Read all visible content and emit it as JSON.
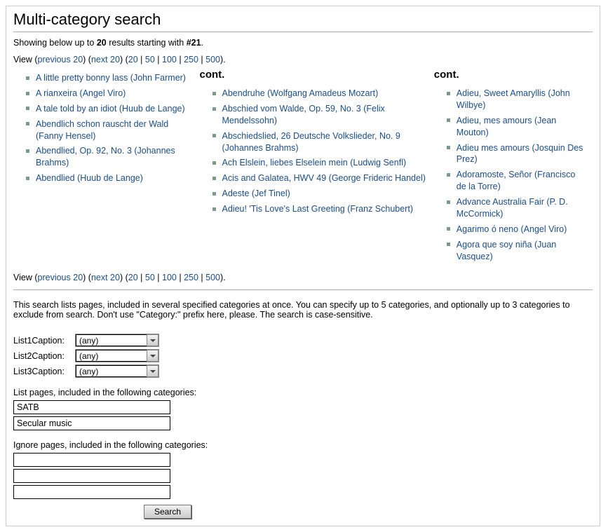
{
  "title": "Multi-category search",
  "summary_pre": "Showing below up to ",
  "summary_count": "20",
  "summary_mid": " results starting with ",
  "summary_start": "#21",
  "summary_post": ".",
  "nav": {
    "view_label": "View (",
    "prev": "previous 20",
    "sep1": ") (",
    "next": "next 20",
    "sep2": ") (",
    "n20": "20",
    "n50": "50",
    "n100": "100",
    "n250": "250",
    "n500": "500",
    "close": ").",
    "pipe": " | "
  },
  "cont_label": "cont.",
  "col1": [
    "A little pretty bonny lass (John Farmer)",
    "A rianxeira (Angel Viro)",
    "A tale told by an idiot (Huub de Lange)",
    "Abendlich schon rauscht der Wald (Fanny Hensel)",
    "Abendlied, Op. 92, No. 3 (Johannes Brahms)",
    "Abendlied (Huub de Lange)"
  ],
  "col2": [
    "Abendruhe (Wolfgang Amadeus Mozart)",
    "Abschied vom Walde, Op. 59, No. 3 (Felix Mendelssohn)",
    "Abschiedslied, 26 Deutsche Volkslieder, No. 9 (Johannes Brahms)",
    "Ach Elslein, liebes Elselein mein (Ludwig Senfl)",
    "Acis and Galatea, HWV 49 (George Frideric Handel)",
    "Adeste (Jef Tinel)",
    "Adieu! 'Tis Love's Last Greeting (Franz Schubert)"
  ],
  "col3": [
    "Adieu, Sweet Amaryllis (John Wilbye)",
    "Adieu, mes amours (Jean Mouton)",
    "Adieu mes amours (Josquin Des Prez)",
    "Adoramoste, Señor (Francisco de la Torre)",
    "Advance Australia Fair (P. D. McCormick)",
    "Agarimo ó neno (Angel Viro)",
    "Agora que soy niña (Juan Vasquez)"
  ],
  "intro": "This search lists pages, included in several specified categories at once. You can specify up to 5 categories, and optionally up to 3 categories to exclude from search. Don't use \"Category:\" prefix here, please. The search is case-sensitive.",
  "lists": {
    "l1": "List1Caption:",
    "l2": "List2Caption:",
    "l3": "List3Caption:",
    "any": "(any)"
  },
  "include_label": "List pages, included in the following categories:",
  "include_vals": [
    "SATB",
    "Secular music"
  ],
  "exclude_label": "Ignore pages, included in the following categories:",
  "search_btn": "Search"
}
